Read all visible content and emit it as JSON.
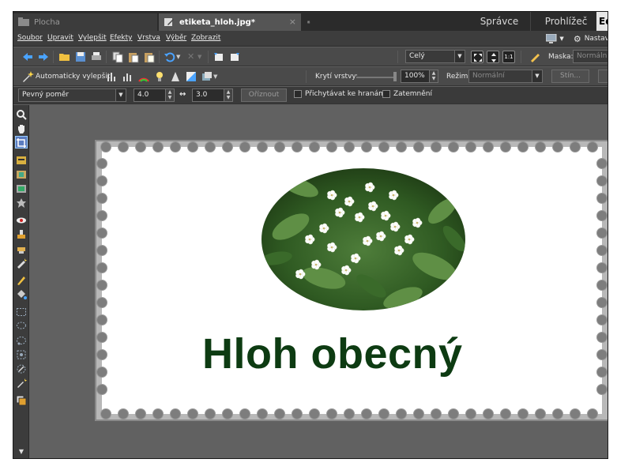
{
  "tabs": [
    {
      "label": "Plocha",
      "active": false
    },
    {
      "label": "etiketa_hloh.jpg*",
      "active": true,
      "close": "×"
    }
  ],
  "modes": {
    "spravce": "Správce",
    "prohlizec": "Prohlížeč",
    "editor": "Ed"
  },
  "menu": {
    "items": [
      "Soubor",
      "Upravit",
      "Vylepšit",
      "Efekty",
      "Vrstva",
      "Výběr",
      "Zobrazit"
    ],
    "right_label": "Nastav"
  },
  "toolbar1": {
    "zoom_value": "Celý",
    "mask_label": "Maska:",
    "mask_value": "Normální"
  },
  "toolbar2": {
    "auto_enhance": "Automaticky vylepšit",
    "opacity_label": "Krytí vrstvy:",
    "opacity_value": "100%",
    "mode_label": "Režim:",
    "mode_value": "Normální",
    "shadow_button": "Stín..."
  },
  "toolbar3": {
    "ratio_value": "Pevný poměr",
    "width_value": "4.0",
    "height_value": "3.0",
    "crop_button": "Oříznout",
    "snap_label": "Přichytávat ke hranám",
    "darken_label": "Zatemnění"
  },
  "image": {
    "caption": "Hloh obecný",
    "caption_color": "#0d3b12"
  },
  "colors": {
    "app_bg": "#5f5f5f",
    "active_tab": "#555555"
  }
}
